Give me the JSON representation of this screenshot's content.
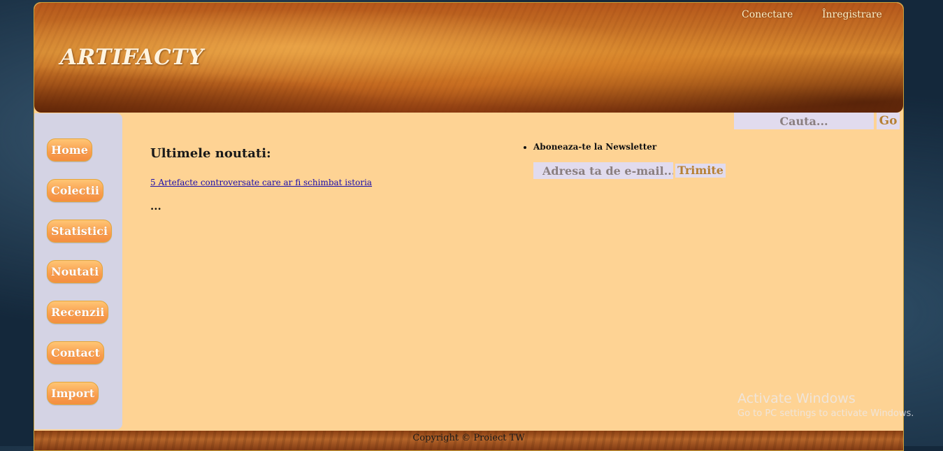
{
  "header": {
    "logo": "ARTIFACTY",
    "links": {
      "login": "Conectare",
      "register": "Înregistrare"
    },
    "search": {
      "placeholder": "Cauta...",
      "button": "Go"
    }
  },
  "sidebar": {
    "items": [
      {
        "label": "Home"
      },
      {
        "label": "Colectii"
      },
      {
        "label": "Statistici"
      },
      {
        "label": "Noutati"
      },
      {
        "label": "Recenzii"
      },
      {
        "label": "Contact"
      },
      {
        "label": "Import"
      }
    ]
  },
  "main": {
    "news_title": "Ultimele noutati:",
    "news_link": "5 Artefacte controversate care ar fi schimbat istoria",
    "ellipsis": "..."
  },
  "newsletter": {
    "label": "Aboneaza-te la Newsletter",
    "email_placeholder": "Adresa ta de e-mail...",
    "submit": "Trimite"
  },
  "footer": {
    "copyright": "Copyright © Proiect TW"
  },
  "watermark": {
    "title": "Activate Windows",
    "subtitle": "Go to PC settings to activate Windows."
  },
  "colors": {
    "page_bg": "#fed394",
    "sidebar_bg": "#d4d3e4",
    "nav_button": "#f99d4e",
    "input_bg": "#e1dbee",
    "button_text": "#b68034"
  }
}
